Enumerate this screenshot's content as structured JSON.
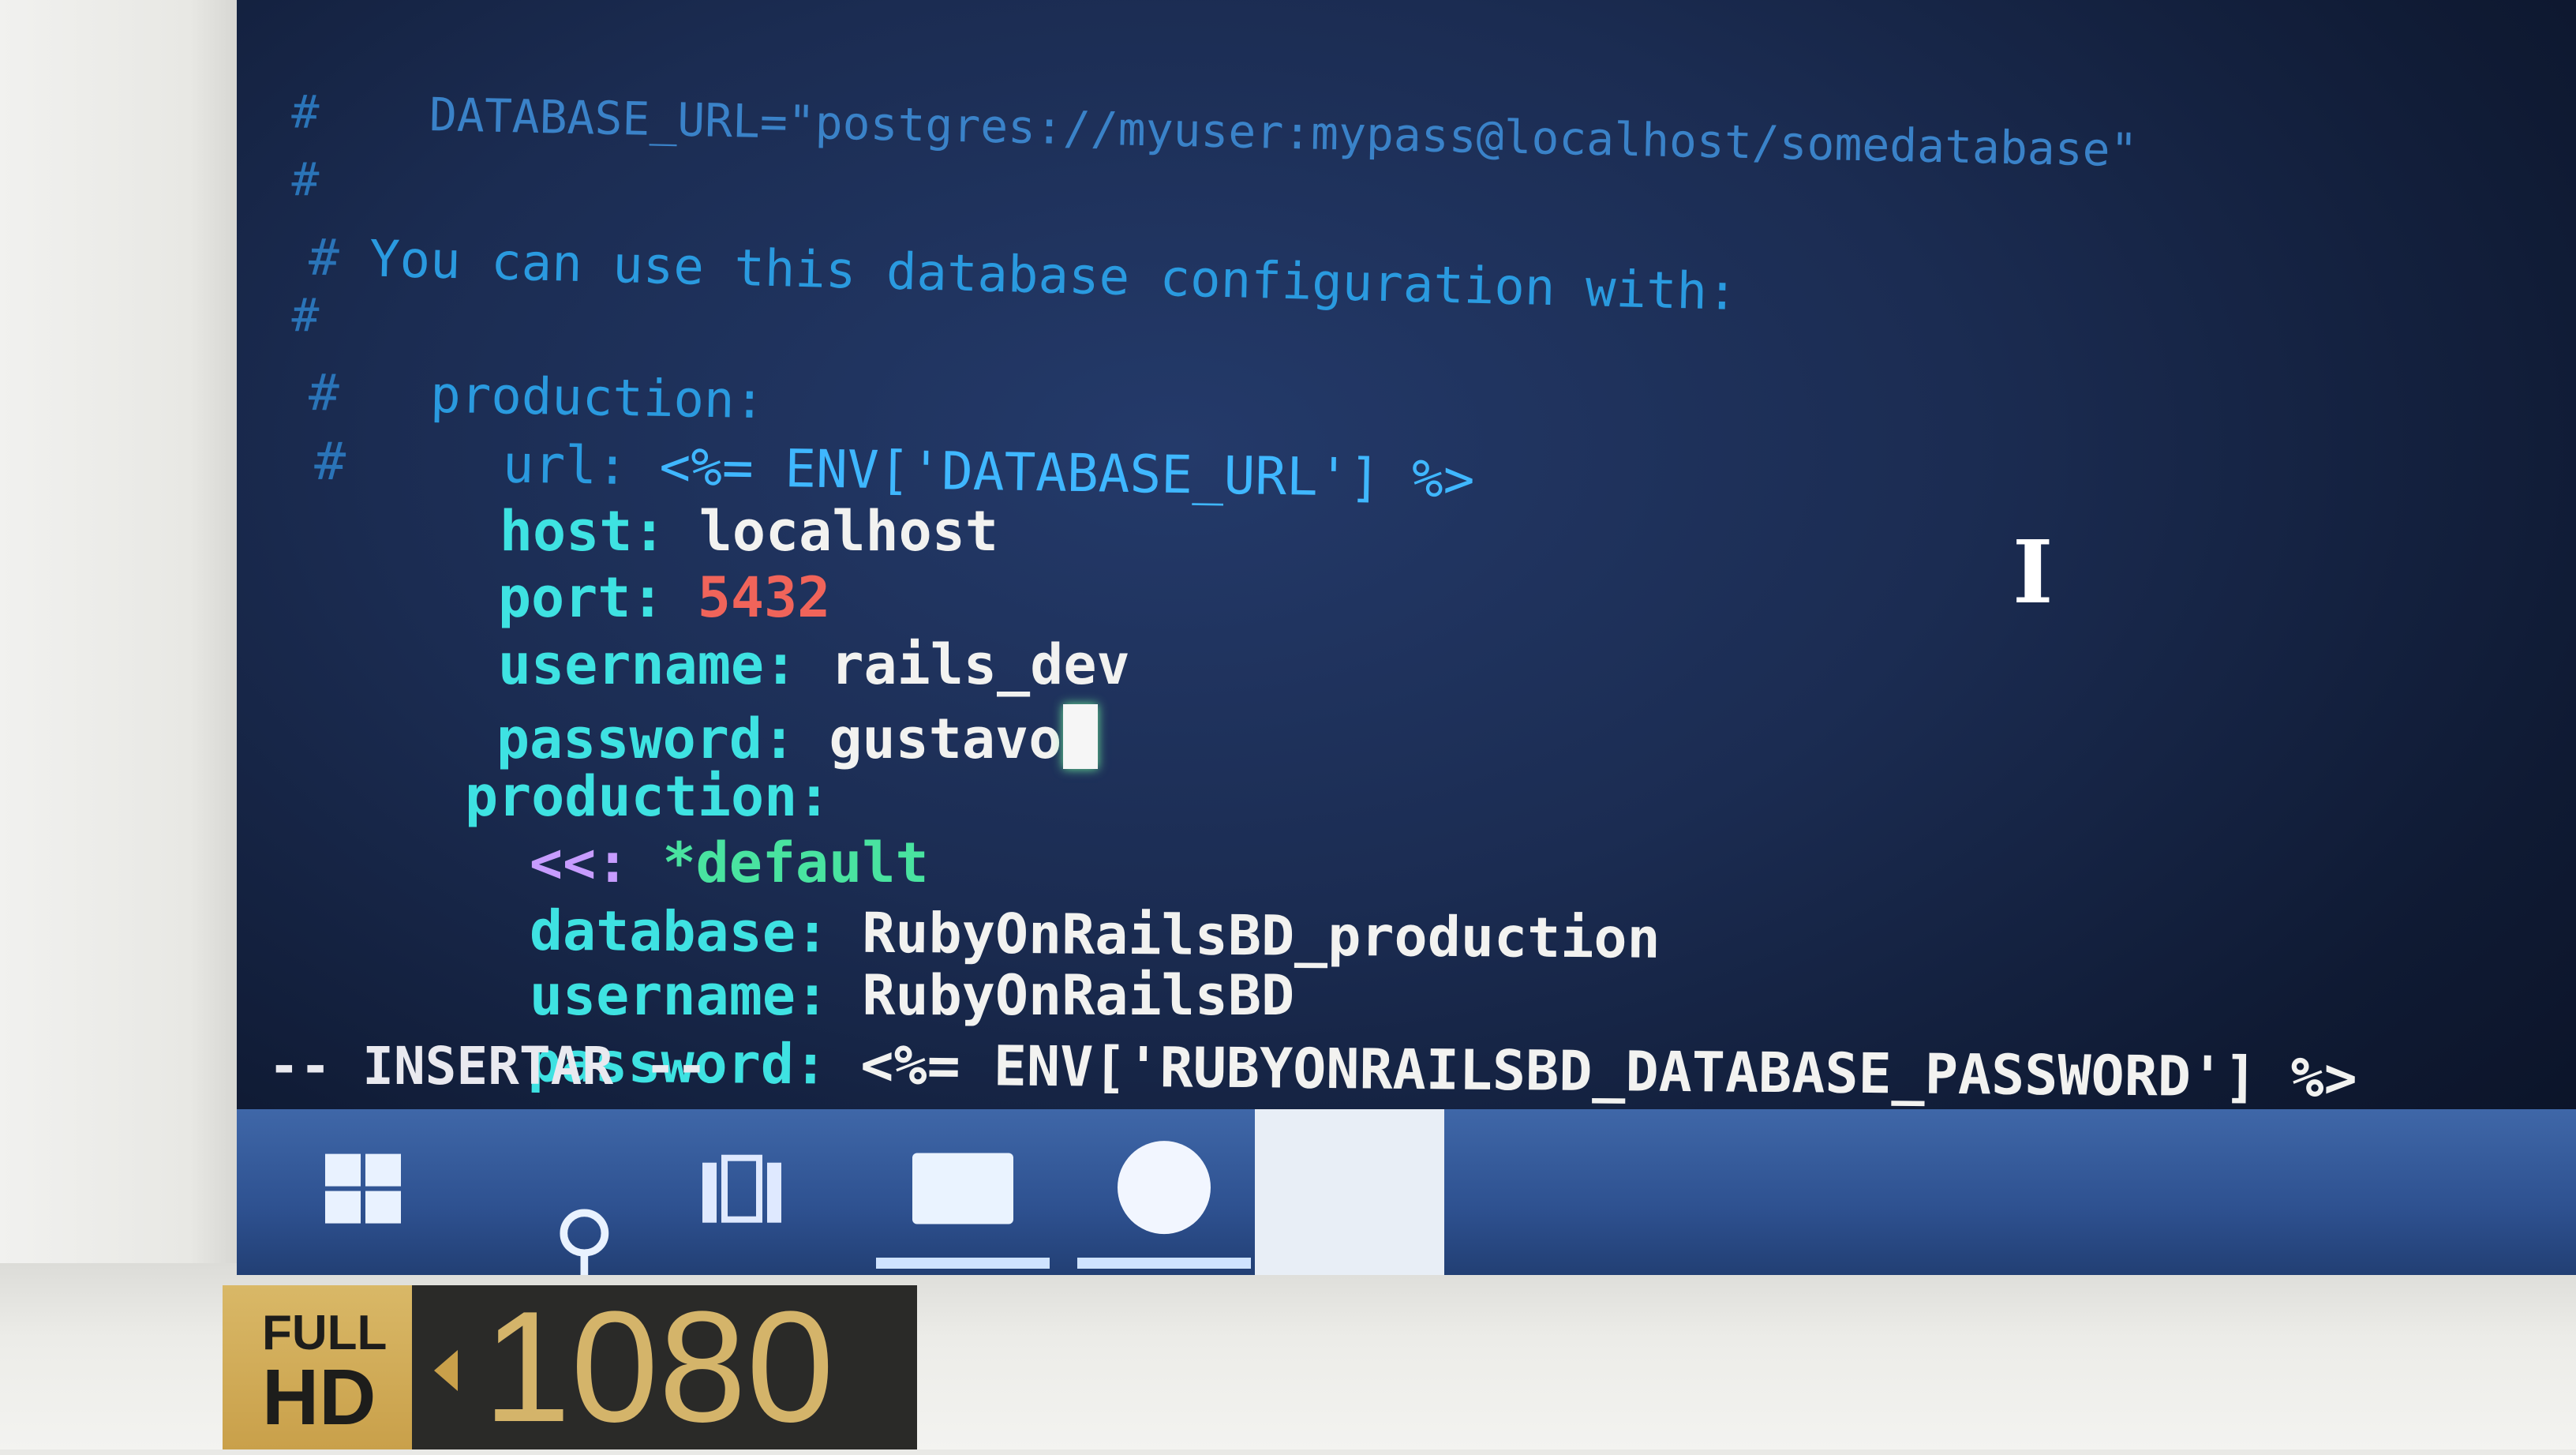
{
  "terminal": {
    "lines": {
      "l0": {
        "hash": "#",
        "text": "DATABASE_URL=\"postgres://myuser:mypass@localhost/somedatabase\""
      },
      "l1": {
        "hash": "#",
        "text": ""
      },
      "l2": {
        "hash": "#",
        "text": "You can use this database configuration with:"
      },
      "l3": {
        "hash": "#",
        "text": ""
      },
      "l4": {
        "hash": "#",
        "text": "production:"
      },
      "l5": {
        "hash": "#",
        "key": "url:",
        "erb": "<%= ENV['DATABASE_URL'] %>"
      },
      "host": {
        "key": "host:",
        "value": "localhost"
      },
      "port": {
        "key": "port:",
        "value": "5432"
      },
      "username": {
        "key": "username:",
        "value": "rails_dev"
      },
      "password": {
        "key": "password:",
        "value": "gustavo"
      },
      "production": {
        "key": "production:"
      },
      "alias": {
        "key": "<<:",
        "value": "*default"
      },
      "prod_database": {
        "key": "database:",
        "value": "RubyOnRailsBD_production"
      },
      "prod_username": {
        "key": "username:",
        "value": "RubyOnRailsBD"
      },
      "prod_password": {
        "key": "password:",
        "value": "<%= ENV['RUBYONRAILSBD_DATABASE_PASSWORD'] %>"
      }
    },
    "mode_line": "-- INSERTAR --"
  },
  "taskbar": {
    "icons": [
      "windows-start-icon",
      "search-icon",
      "task-view-icon",
      "file-explorer-icon",
      "browser-icon",
      "active-window-icon"
    ]
  },
  "sticker": {
    "full": "FULL",
    "hd": "HD",
    "resolution": "1080"
  },
  "colors": {
    "screen_bg": "#1b2c52",
    "comment": "#2a9adf",
    "key": "#3ee2e2",
    "value": "#f2f2f0",
    "number": "#f0645a",
    "taskbar": "#2e5190"
  }
}
